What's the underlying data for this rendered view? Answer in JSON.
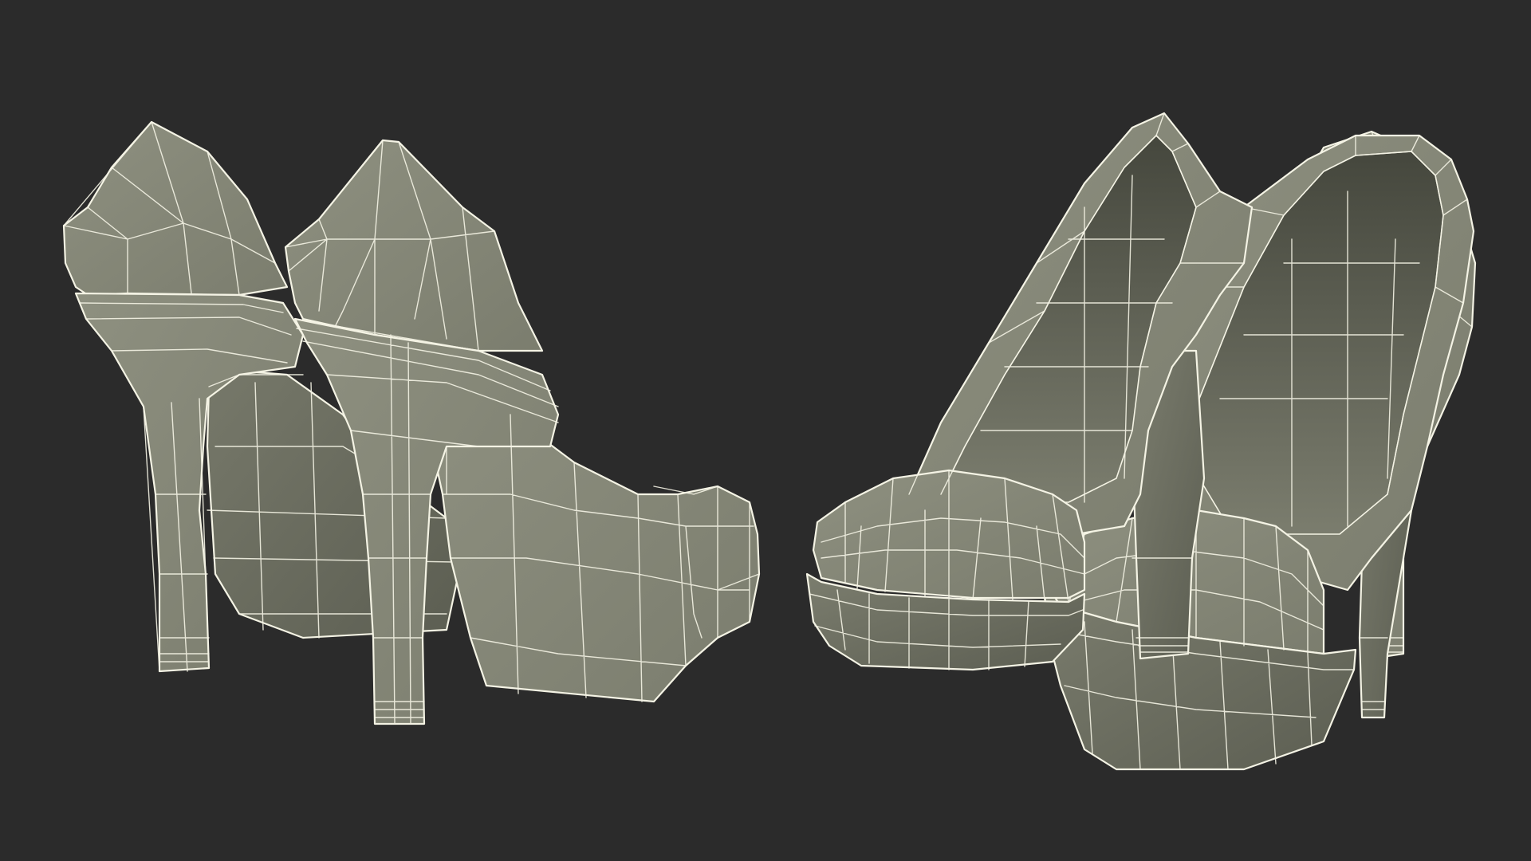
{
  "scene": {
    "subject": "platform-high-heel-pump-pair",
    "views": [
      "rear-view",
      "front-view"
    ],
    "shading": "wireframe-over-clay",
    "colors": {
      "background": "#2b2b2b",
      "surface": "#7b7d6e",
      "surface_light": "#8e9080",
      "surface_dark": "#5c5e52",
      "interior": "#45473d",
      "wire": "#f4f3e4"
    }
  }
}
